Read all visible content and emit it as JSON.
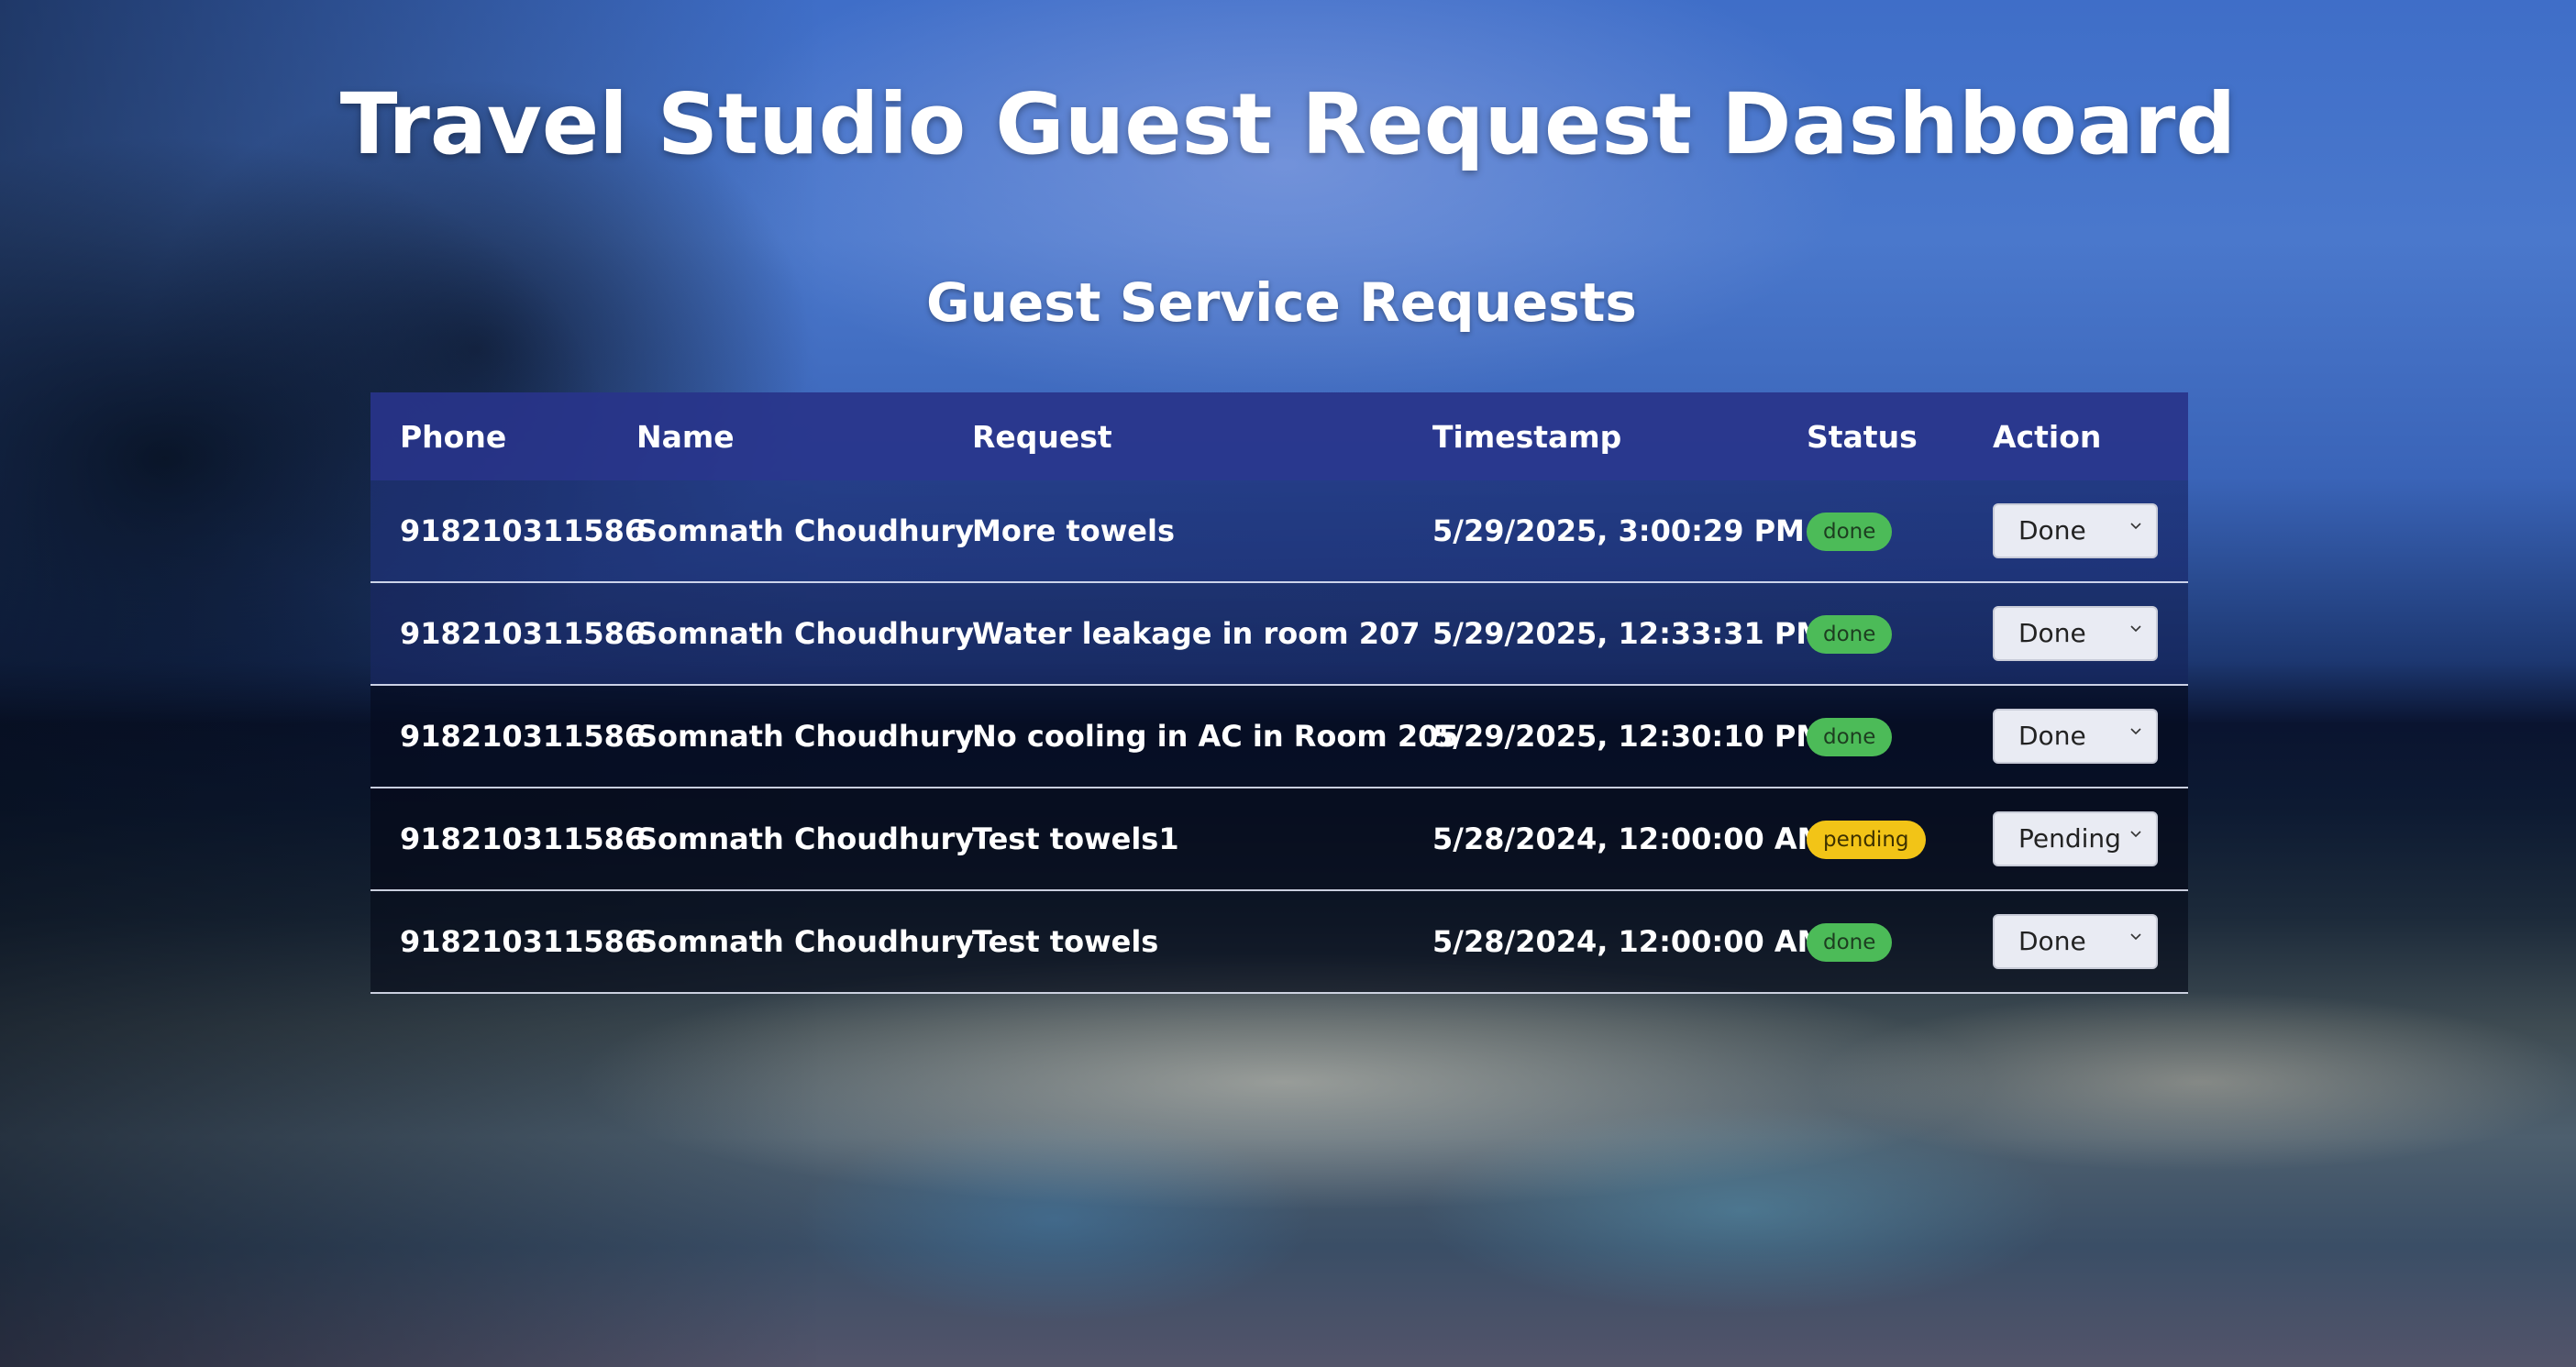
{
  "header": {
    "title": "Travel Studio Guest Request Dashboard",
    "subtitle": "Guest Service Requests"
  },
  "table": {
    "columns": [
      "Phone",
      "Name",
      "Request",
      "Timestamp",
      "Status",
      "Action"
    ],
    "rows": [
      {
        "phone": "918210311586",
        "name": "Somnath Choudhury",
        "request": "More towels",
        "timestamp": "5/29/2025, 3:00:29 PM",
        "status": "done",
        "action": "Done"
      },
      {
        "phone": "918210311586",
        "name": "Somnath Choudhury",
        "request": "Water leakage in room 207",
        "timestamp": "5/29/2025, 12:33:31 PM",
        "status": "done",
        "action": "Done"
      },
      {
        "phone": "918210311586",
        "name": "Somnath Choudhury",
        "request": "No cooling in AC in Room 205",
        "timestamp": "5/29/2025, 12:30:10 PM",
        "status": "done",
        "action": "Done"
      },
      {
        "phone": "918210311586",
        "name": "Somnath Choudhury",
        "request": "Test towels1",
        "timestamp": "5/28/2024, 12:00:00 AM",
        "status": "pending",
        "action": "Pending"
      },
      {
        "phone": "918210311586",
        "name": "Somnath Choudhury",
        "request": "Test towels",
        "timestamp": "5/28/2024, 12:00:00 AM",
        "status": "done",
        "action": "Done"
      }
    ]
  },
  "colors": {
    "header_bg": "#28348a",
    "done_badge": "#4cbb58",
    "pending_badge": "#f2c417",
    "select_bg": "#e9ebf3"
  },
  "icons": {
    "select_arrow": "chevron-down-icon"
  }
}
